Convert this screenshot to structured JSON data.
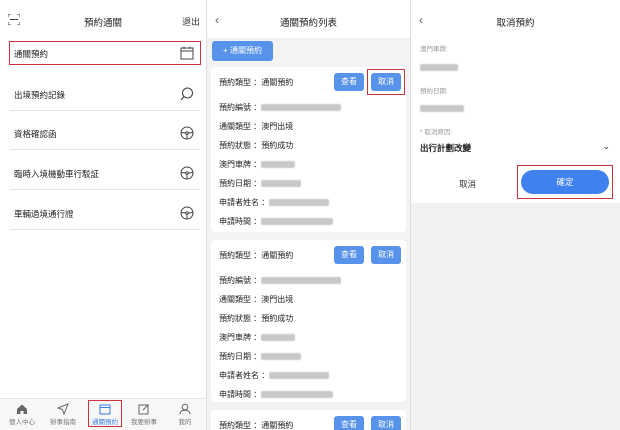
{
  "screen1": {
    "title": "預約通關",
    "logout": "退出",
    "menu": [
      {
        "label": "通關預約"
      },
      {
        "label": "出境預約記錄"
      },
      {
        "label": "資格確認函"
      },
      {
        "label": "臨時入境機動車行駁証"
      },
      {
        "label": "車輛過境通行證"
      }
    ],
    "nav": [
      {
        "label": "個人中心",
        "icon": "home-icon"
      },
      {
        "label": "辦事指南",
        "icon": "send-icon"
      },
      {
        "label": "通關預約",
        "icon": "calendar-icon"
      },
      {
        "label": "我要辦事",
        "icon": "edit-icon"
      },
      {
        "label": "我的",
        "icon": "user-icon"
      }
    ]
  },
  "screen2": {
    "title": "通關預約列表",
    "add_button": "+ 通關預約",
    "view_label": "查看",
    "cancel_label": "取消",
    "card1": {
      "type_label": "預約類型 ：",
      "type_value": "通關預約",
      "rows": [
        {
          "label": "預約編號 ：",
          "value": ""
        },
        {
          "label": "通關類型 ：",
          "value": "澳門出境"
        },
        {
          "label": "預約狀態 ：",
          "value": "預約成功"
        },
        {
          "label": "澳門車牌 ：",
          "value": ""
        },
        {
          "label": "預約日期 ：",
          "value": ""
        },
        {
          "label": "申請者姓名 ：",
          "value": ""
        },
        {
          "label": "申請時間 ：",
          "value": ""
        }
      ]
    },
    "card2": {
      "type_label": "預約類型 ：",
      "type_value": "通關預約",
      "rows": [
        {
          "label": "預約編號 ：",
          "value": ""
        },
        {
          "label": "通關類型 ：",
          "value": "澳門出境"
        },
        {
          "label": "預約狀態 ：",
          "value": "預約成功"
        },
        {
          "label": "澳門車牌 ：",
          "value": ""
        },
        {
          "label": "預約日期 ：",
          "value": ""
        },
        {
          "label": "申請者姓名 ：",
          "value": ""
        },
        {
          "label": "申請時間 ：",
          "value": ""
        }
      ]
    },
    "card3": {
      "type_label": "預約類型 ：",
      "type_value": "通關預約"
    }
  },
  "screen3": {
    "title": "取消預約",
    "plate_label": "澳門車牌:",
    "date_label": "預約日期:",
    "reason_label": "* 取消原因:",
    "reason_value": "出行計劃改變",
    "cancel_label": "取消",
    "confirm_label": "確定"
  },
  "colors": {
    "accent_blue": "#5793ea",
    "confirm_blue": "#3f82ef",
    "highlight_red": "#c9333b"
  }
}
